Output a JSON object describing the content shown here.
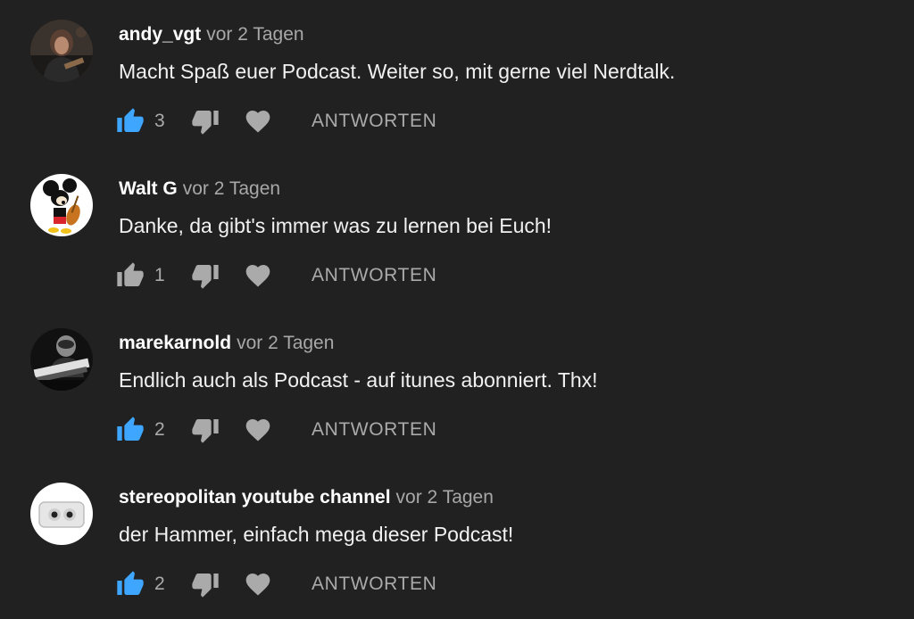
{
  "colors": {
    "background": "#212121",
    "liked_thumb": "#3ea6ff",
    "icon_gray": "#aaaaaa"
  },
  "comments": [
    {
      "author": "andy_vgt",
      "time": "vor 2 Tagen",
      "text": "Macht Spaß euer Podcast. Weiter so, mit gerne viel Nerdtalk.",
      "likes": "3",
      "liked": true,
      "reply_label": "ANTWORTEN",
      "avatar_icon": "person-with-guitar-avatar"
    },
    {
      "author": "Walt G",
      "time": "vor 2 Tagen",
      "text": "Danke, da gibt's immer was zu lernen bei Euch!",
      "likes": "1",
      "liked": false,
      "reply_label": "ANTWORTEN",
      "avatar_icon": "cartoon-mouse-avatar"
    },
    {
      "author": "marekarnold",
      "time": "vor 2 Tagen",
      "text": "Endlich auch als Podcast - auf itunes abonniert. Thx!",
      "likes": "2",
      "liked": true,
      "reply_label": "ANTWORTEN",
      "avatar_icon": "person-with-synthesizer-avatar"
    },
    {
      "author": "stereopolitan youtube channel",
      "time": "vor 2 Tagen",
      "text": "der Hammer, einfach mega dieser Podcast!",
      "likes": "2",
      "liked": true,
      "reply_label": "ANTWORTEN",
      "avatar_icon": "speaker-logo-avatar"
    }
  ]
}
